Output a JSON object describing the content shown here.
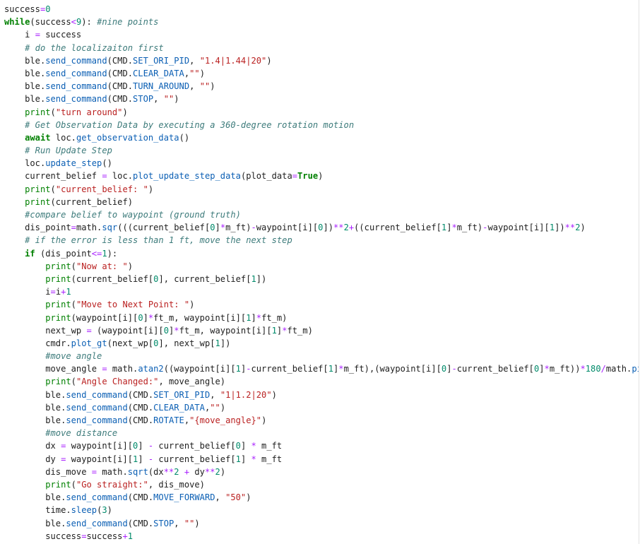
{
  "editor": {
    "language": "python",
    "colors": {
      "background": "#ffffff",
      "text": "#202020",
      "keyword": "#008000",
      "builtin": "#008000",
      "function": "#0b5fb4",
      "string": "#ba2121",
      "number": "#008a6a",
      "operator": "#aa22ff",
      "comment": "#3d7b7b"
    },
    "lines": [
      [
        [
          "success",
          "t"
        ],
        [
          "=",
          "o"
        ],
        [
          "0",
          "n"
        ]
      ],
      [
        [
          "while",
          "k"
        ],
        [
          "(success",
          "t"
        ],
        [
          "<",
          "o"
        ],
        [
          "9",
          "n"
        ],
        [
          "): ",
          "t"
        ],
        [
          "#nine points",
          "c"
        ]
      ],
      [
        [
          "    i ",
          "t"
        ],
        [
          "=",
          "o"
        ],
        [
          " success",
          "t"
        ]
      ],
      [
        [
          "    ",
          "t"
        ],
        [
          "# do the localizaiton first",
          "c"
        ]
      ],
      [
        [
          "    ble.",
          "t"
        ],
        [
          "send_command",
          "f"
        ],
        [
          "(CMD.",
          "t"
        ],
        [
          "SET_ORI_PID",
          "x"
        ],
        [
          ", ",
          "t"
        ],
        [
          "\"1.4|1.44|20\"",
          "s"
        ],
        [
          ")",
          "t"
        ]
      ],
      [
        [
          "    ble.",
          "t"
        ],
        [
          "send_command",
          "f"
        ],
        [
          "(CMD.",
          "t"
        ],
        [
          "CLEAR_DATA",
          "x"
        ],
        [
          ",",
          "t"
        ],
        [
          "\"\"",
          "s"
        ],
        [
          ")",
          "t"
        ]
      ],
      [
        [
          "    ble.",
          "t"
        ],
        [
          "send_command",
          "f"
        ],
        [
          "(CMD.",
          "t"
        ],
        [
          "TURN_AROUND",
          "x"
        ],
        [
          ", ",
          "t"
        ],
        [
          "\"\"",
          "s"
        ],
        [
          ")",
          "t"
        ]
      ],
      [
        [
          "    ble.",
          "t"
        ],
        [
          "send_command",
          "f"
        ],
        [
          "(CMD.",
          "t"
        ],
        [
          "STOP",
          "x"
        ],
        [
          ", ",
          "t"
        ],
        [
          "\"\"",
          "s"
        ],
        [
          ")",
          "t"
        ]
      ],
      [
        [
          "    ",
          "t"
        ],
        [
          "print",
          "b"
        ],
        [
          "(",
          "t"
        ],
        [
          "\"turn around\"",
          "s"
        ],
        [
          ")",
          "t"
        ]
      ],
      [
        [
          "    ",
          "t"
        ],
        [
          "# Get Observation Data by executing a 360-degree rotation motion",
          "c"
        ]
      ],
      [
        [
          "    ",
          "t"
        ],
        [
          "await",
          "k"
        ],
        [
          " loc.",
          "t"
        ],
        [
          "get_observation_data",
          "f"
        ],
        [
          "()",
          "t"
        ]
      ],
      [
        [
          "    ",
          "t"
        ],
        [
          "# Run Update Step",
          "c"
        ]
      ],
      [
        [
          "    loc.",
          "t"
        ],
        [
          "update_step",
          "f"
        ],
        [
          "()",
          "t"
        ]
      ],
      [
        [
          "    current_belief ",
          "t"
        ],
        [
          "=",
          "o"
        ],
        [
          " loc.",
          "t"
        ],
        [
          "plot_update_step_data",
          "f"
        ],
        [
          "(plot_data",
          "t"
        ],
        [
          "=",
          "o"
        ],
        [
          "True",
          "k"
        ],
        [
          ")",
          "t"
        ]
      ],
      [
        [
          "    ",
          "t"
        ],
        [
          "print",
          "b"
        ],
        [
          "(",
          "t"
        ],
        [
          "\"current_belief: \"",
          "s"
        ],
        [
          ")",
          "t"
        ]
      ],
      [
        [
          "    ",
          "t"
        ],
        [
          "print",
          "b"
        ],
        [
          "(current_belief)",
          "t"
        ]
      ],
      [
        [
          "    ",
          "t"
        ],
        [
          "#compare belief to waypoint (ground truth)",
          "c"
        ]
      ],
      [
        [
          "    dis_point",
          "t"
        ],
        [
          "=",
          "o"
        ],
        [
          "math.",
          "t"
        ],
        [
          "sqr",
          "f"
        ],
        [
          "(((current_belief[",
          "t"
        ],
        [
          "0",
          "n"
        ],
        [
          "]",
          "t"
        ],
        [
          "*",
          "o"
        ],
        [
          "m_ft)",
          "t"
        ],
        [
          "-",
          "o"
        ],
        [
          "waypoint[i][",
          "t"
        ],
        [
          "0",
          "n"
        ],
        [
          "])",
          "t"
        ],
        [
          "**",
          "o"
        ],
        [
          "2",
          "n"
        ],
        [
          "+",
          "o"
        ],
        [
          "((current_belief[",
          "t"
        ],
        [
          "1",
          "n"
        ],
        [
          "]",
          "t"
        ],
        [
          "*",
          "o"
        ],
        [
          "m_ft)",
          "t"
        ],
        [
          "-",
          "o"
        ],
        [
          "waypoint[i][",
          "t"
        ],
        [
          "1",
          "n"
        ],
        [
          "])",
          "t"
        ],
        [
          "**",
          "o"
        ],
        [
          "2",
          "n"
        ],
        [
          ")",
          "t"
        ]
      ],
      [
        [
          "    ",
          "t"
        ],
        [
          "# if the error is less than 1 ft, move the next step",
          "c"
        ]
      ],
      [
        [
          "    ",
          "t"
        ],
        [
          "if",
          "k"
        ],
        [
          " (dis_point",
          "t"
        ],
        [
          "<=",
          "o"
        ],
        [
          "1",
          "n"
        ],
        [
          "):",
          "t"
        ]
      ],
      [
        [
          "        ",
          "t"
        ],
        [
          "print",
          "b"
        ],
        [
          "(",
          "t"
        ],
        [
          "\"Now at: \"",
          "s"
        ],
        [
          ")",
          "t"
        ]
      ],
      [
        [
          "        ",
          "t"
        ],
        [
          "print",
          "b"
        ],
        [
          "(current_belief[",
          "t"
        ],
        [
          "0",
          "n"
        ],
        [
          "], current_belief[",
          "t"
        ],
        [
          "1",
          "n"
        ],
        [
          "])",
          "t"
        ]
      ],
      [
        [
          "        i",
          "t"
        ],
        [
          "=",
          "o"
        ],
        [
          "i",
          "t"
        ],
        [
          "+",
          "o"
        ],
        [
          "1",
          "n"
        ]
      ],
      [
        [
          "        ",
          "t"
        ],
        [
          "print",
          "b"
        ],
        [
          "(",
          "t"
        ],
        [
          "\"Move to Next Point: \"",
          "s"
        ],
        [
          ")",
          "t"
        ]
      ],
      [
        [
          "        ",
          "t"
        ],
        [
          "print",
          "b"
        ],
        [
          "(waypoint[i][",
          "t"
        ],
        [
          "0",
          "n"
        ],
        [
          "]",
          "t"
        ],
        [
          "*",
          "o"
        ],
        [
          "ft_m, waypoint[i][",
          "t"
        ],
        [
          "1",
          "n"
        ],
        [
          "]",
          "t"
        ],
        [
          "*",
          "o"
        ],
        [
          "ft_m)",
          "t"
        ]
      ],
      [
        [
          "        next_wp ",
          "t"
        ],
        [
          "=",
          "o"
        ],
        [
          " (waypoint[i][",
          "t"
        ],
        [
          "0",
          "n"
        ],
        [
          "]",
          "t"
        ],
        [
          "*",
          "o"
        ],
        [
          "ft_m, waypoint[i][",
          "t"
        ],
        [
          "1",
          "n"
        ],
        [
          "]",
          "t"
        ],
        [
          "*",
          "o"
        ],
        [
          "ft_m)",
          "t"
        ]
      ],
      [
        [
          "        cmdr.",
          "t"
        ],
        [
          "plot_gt",
          "f"
        ],
        [
          "(next_wp[",
          "t"
        ],
        [
          "0",
          "n"
        ],
        [
          "], next_wp[",
          "t"
        ],
        [
          "1",
          "n"
        ],
        [
          "])",
          "t"
        ]
      ],
      [
        [
          "        ",
          "t"
        ],
        [
          "#move angle",
          "c"
        ]
      ],
      [
        [
          "        move_angle ",
          "t"
        ],
        [
          "=",
          "o"
        ],
        [
          " math.",
          "t"
        ],
        [
          "atan2",
          "f"
        ],
        [
          "((waypoint[i][",
          "t"
        ],
        [
          "1",
          "n"
        ],
        [
          "]",
          "t"
        ],
        [
          "-",
          "o"
        ],
        [
          "current_belief[",
          "t"
        ],
        [
          "1",
          "n"
        ],
        [
          "]",
          "t"
        ],
        [
          "*",
          "o"
        ],
        [
          "m_ft),(waypoint[i][",
          "t"
        ],
        [
          "0",
          "n"
        ],
        [
          "]",
          "t"
        ],
        [
          "-",
          "o"
        ],
        [
          "current_belief[",
          "t"
        ],
        [
          "0",
          "n"
        ],
        [
          "]",
          "t"
        ],
        [
          "*",
          "o"
        ],
        [
          "m_ft))",
          "t"
        ],
        [
          "*",
          "o"
        ],
        [
          "180",
          "n"
        ],
        [
          "/",
          "o"
        ],
        [
          "math.",
          "t"
        ],
        [
          "pi",
          "f"
        ]
      ],
      [
        [
          "        ",
          "t"
        ],
        [
          "print",
          "b"
        ],
        [
          "(",
          "t"
        ],
        [
          "\"Angle Changed:\"",
          "s"
        ],
        [
          ", move_angle)",
          "t"
        ]
      ],
      [
        [
          "        ble.",
          "t"
        ],
        [
          "send_command",
          "f"
        ],
        [
          "(CMD.",
          "t"
        ],
        [
          "SET_ORI_PID",
          "x"
        ],
        [
          ", ",
          "t"
        ],
        [
          "\"1|1.2|20\"",
          "s"
        ],
        [
          ")",
          "t"
        ]
      ],
      [
        [
          "        ble.",
          "t"
        ],
        [
          "send_command",
          "f"
        ],
        [
          "(CMD.",
          "t"
        ],
        [
          "CLEAR_DATA",
          "x"
        ],
        [
          ",",
          "t"
        ],
        [
          "\"\"",
          "s"
        ],
        [
          ")",
          "t"
        ]
      ],
      [
        [
          "        ble.",
          "t"
        ],
        [
          "send_command",
          "f"
        ],
        [
          "(CMD.",
          "t"
        ],
        [
          "ROTATE",
          "x"
        ],
        [
          ",",
          "t"
        ],
        [
          "\"{move_angle}\"",
          "s"
        ],
        [
          ")",
          "t"
        ]
      ],
      [
        [
          "        ",
          "t"
        ],
        [
          "#move distance",
          "c"
        ]
      ],
      [
        [
          "        dx ",
          "t"
        ],
        [
          "=",
          "o"
        ],
        [
          " waypoint[i][",
          "t"
        ],
        [
          "0",
          "n"
        ],
        [
          "] ",
          "t"
        ],
        [
          "-",
          "o"
        ],
        [
          " current_belief[",
          "t"
        ],
        [
          "0",
          "n"
        ],
        [
          "] ",
          "t"
        ],
        [
          "*",
          "o"
        ],
        [
          " m_ft",
          "t"
        ]
      ],
      [
        [
          "        dy ",
          "t"
        ],
        [
          "=",
          "o"
        ],
        [
          " waypoint[i][",
          "t"
        ],
        [
          "1",
          "n"
        ],
        [
          "] ",
          "t"
        ],
        [
          "-",
          "o"
        ],
        [
          " current_belief[",
          "t"
        ],
        [
          "1",
          "n"
        ],
        [
          "] ",
          "t"
        ],
        [
          "*",
          "o"
        ],
        [
          " m_ft",
          "t"
        ]
      ],
      [
        [
          "        dis_move ",
          "t"
        ],
        [
          "=",
          "o"
        ],
        [
          " math.",
          "t"
        ],
        [
          "sqrt",
          "f"
        ],
        [
          "(dx",
          "t"
        ],
        [
          "**",
          "o"
        ],
        [
          "2",
          "n"
        ],
        [
          " ",
          "t"
        ],
        [
          "+",
          "o"
        ],
        [
          " dy",
          "t"
        ],
        [
          "**",
          "o"
        ],
        [
          "2",
          "n"
        ],
        [
          ")",
          "t"
        ]
      ],
      [
        [
          "        ",
          "t"
        ],
        [
          "print",
          "b"
        ],
        [
          "(",
          "t"
        ],
        [
          "\"Go straight:\"",
          "s"
        ],
        [
          ", dis_move)",
          "t"
        ]
      ],
      [
        [
          "        ble.",
          "t"
        ],
        [
          "send_command",
          "f"
        ],
        [
          "(CMD.",
          "t"
        ],
        [
          "MOVE_FORWARD",
          "x"
        ],
        [
          ", ",
          "t"
        ],
        [
          "\"50\"",
          "s"
        ],
        [
          ")",
          "t"
        ]
      ],
      [
        [
          "        time.",
          "t"
        ],
        [
          "sleep",
          "f"
        ],
        [
          "(",
          "t"
        ],
        [
          "3",
          "n"
        ],
        [
          ")",
          "t"
        ]
      ],
      [
        [
          "        ble.",
          "t"
        ],
        [
          "send_command",
          "f"
        ],
        [
          "(CMD.",
          "t"
        ],
        [
          "STOP",
          "x"
        ],
        [
          ", ",
          "t"
        ],
        [
          "\"\"",
          "s"
        ],
        [
          ")",
          "t"
        ]
      ],
      [
        [
          "        success",
          "t"
        ],
        [
          "=",
          "o"
        ],
        [
          "success",
          "t"
        ],
        [
          "+",
          "o"
        ],
        [
          "1",
          "n"
        ]
      ]
    ]
  }
}
